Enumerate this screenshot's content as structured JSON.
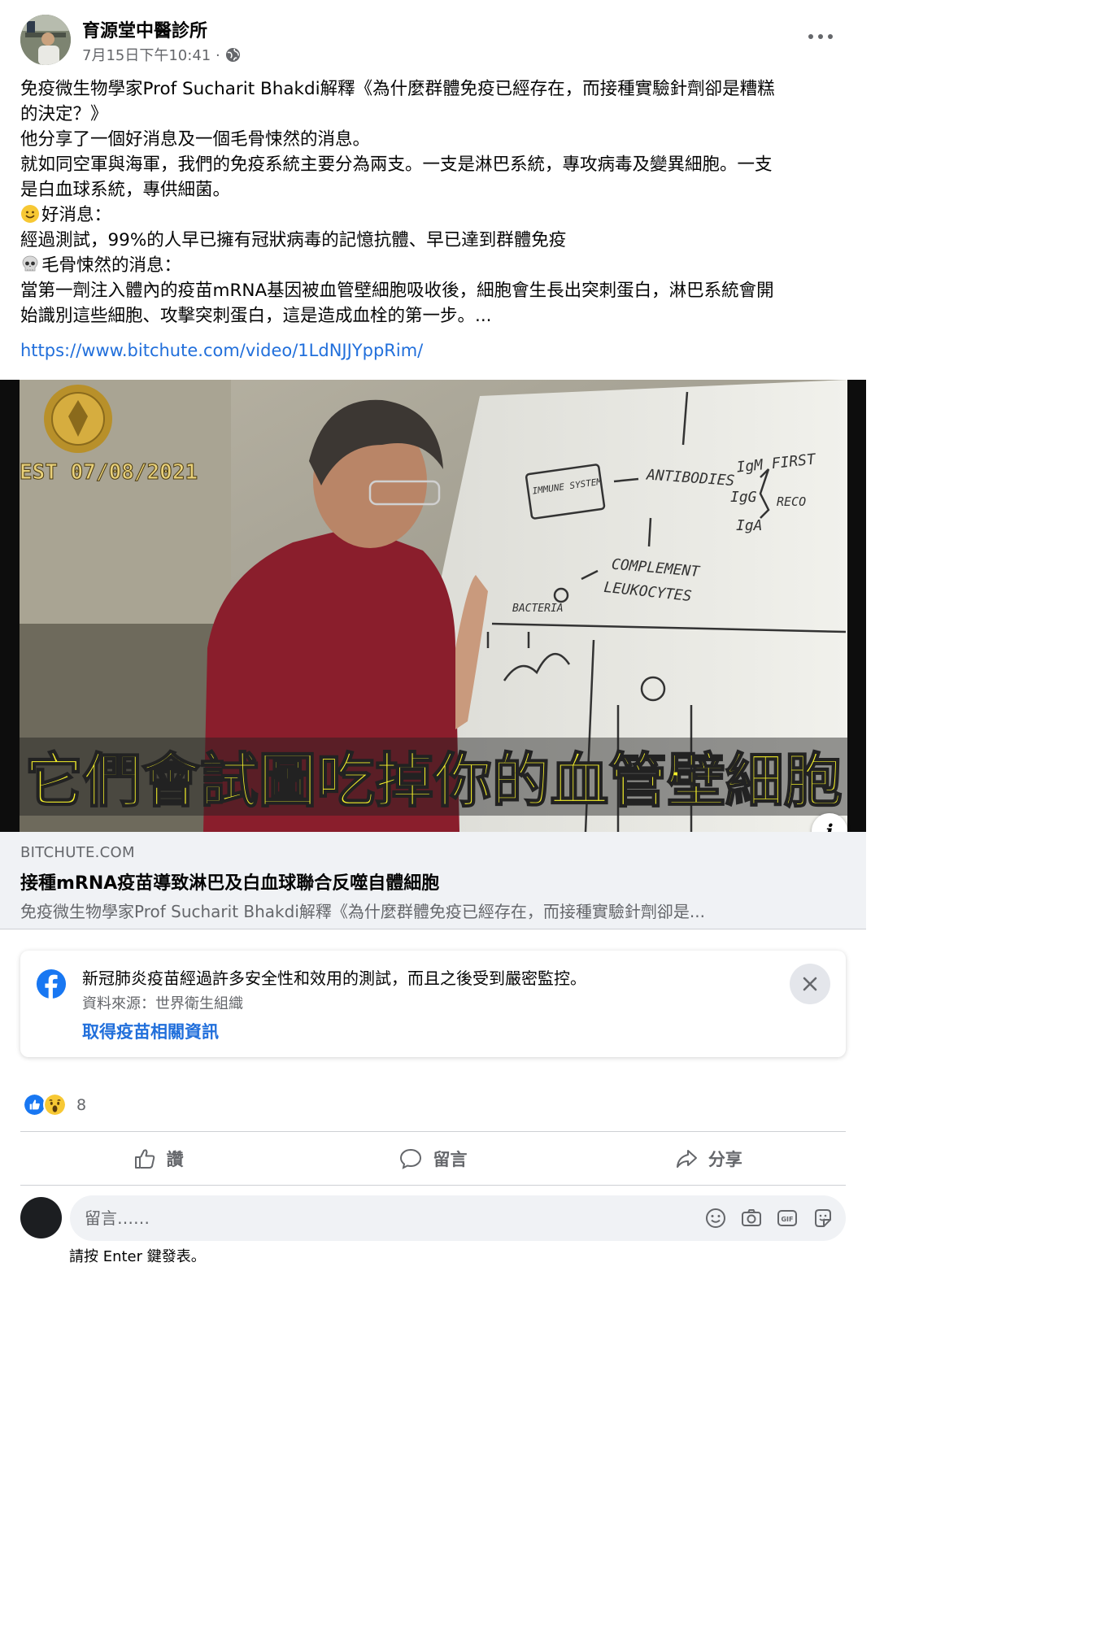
{
  "post": {
    "author": "育源堂中醫診所",
    "timestamp": "7月15日下午10:41 ·",
    "privacy_icon": "globe-icon",
    "body": [
      {
        "text": "免疫微生物學家Prof Sucharit Bhakdi解釋《為什麼群體免疫已經存在，而接種實驗針劑卻是糟糕"
      },
      {
        "text": "的決定？》"
      },
      {
        "text": "他分享了一個好消息及一個毛骨悚然的消息。"
      },
      {
        "text": "就如同空軍與海軍，我們的免疫系統主要分為兩支。一支是淋巴系統，專攻病毒及變異細胞。一支"
      },
      {
        "text": "是白血球系統，專供細菌。"
      },
      {
        "emoji": "smile-emoji",
        "text": "好消息："
      },
      {
        "text": "經過測試，99%的人早已擁有冠狀病毒的記憶抗體、早已達到群體免疫"
      },
      {
        "emoji": "skull-emoji",
        "text": "毛骨悚然的消息："
      },
      {
        "text": "當第一劑注入體內的疫苗mRNA基因被血管壁細胞吸收後，細胞會生長出突刺蛋白，淋巴系統會開"
      },
      {
        "text": "始識別這些細胞、攻擊突刺蛋白，這是造成血栓的第一步。..."
      }
    ],
    "link_url": "https://www.bitchute.com/video/1LdNJJYppRim/"
  },
  "media": {
    "watermark_date": "EST 07/08/2021",
    "subtitle": "它們會試圖吃掉你的血管壁細胞",
    "whiteboard_notes": [
      "IMMUNE SYSTEM",
      "ANTIBODIES",
      "IgM FIRST",
      "IgG",
      "IgA",
      "RECO",
      "COMPLEMENT",
      "LEUKOCYTES",
      "BACTERIA"
    ]
  },
  "link_preview": {
    "domain": "BITCHUTE.COM",
    "title": "接種mRNA疫苗導致淋巴及白血球聯合反噬自體細胞",
    "description": "免疫微生物學家Prof Sucharit Bhakdi解釋《為什麼群體免疫已經存在，而接種實驗針劑卻是..."
  },
  "info_card": {
    "text": "新冠肺炎疫苗經過許多安全性和效用的測試，而且之後受到嚴密監控。",
    "source": "資料來源：世界衛生組織",
    "link": "取得疫苗相關資訊"
  },
  "reactions": {
    "types": [
      "like",
      "wow"
    ],
    "count": "8"
  },
  "actions": {
    "like": "讚",
    "comment": "留言",
    "share": "分享"
  },
  "comment": {
    "placeholder": "留言……",
    "hint": "請按 Enter 鍵發表。",
    "icons": [
      "emoji-icon",
      "camera-icon",
      "gif-icon",
      "sticker-icon"
    ]
  },
  "colors": {
    "link": "#216fdb",
    "secondary_text": "#65676b",
    "subtitle_yellow": "#f5f02a",
    "facebook_blue": "#1877f2"
  }
}
